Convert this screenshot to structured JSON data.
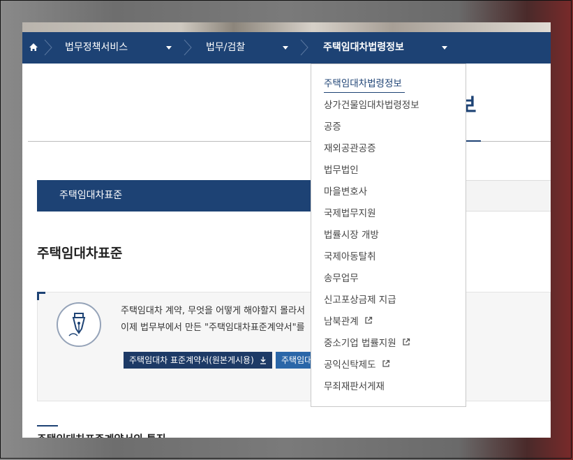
{
  "nav": {
    "items": [
      {
        "label": "법무정책서비스"
      },
      {
        "label": "법무/검찰"
      },
      {
        "label": "주택임대차법령정보"
      }
    ]
  },
  "page": {
    "title_partial": "보",
    "tab_active": "주택임대차표준",
    "section_title": "주택임대차표준",
    "info_line1": "주택임대차 계약, 무엇을 어떻게 해야할지 몰라서",
    "info_line2": "이제 법무부에서 만든 \"주택임대차표준계약서\"를",
    "btn_download": "주택임대차 표준계약서(원본게시용)",
    "btn_partial": "주택임대",
    "bottom_title": "주택임대차표준계약서의 특징"
  },
  "dropdown": {
    "items": [
      {
        "label": "주택임대차법령정보",
        "active": true,
        "external": false
      },
      {
        "label": "상가건물임대차법령정보",
        "external": false
      },
      {
        "label": "공증",
        "external": false
      },
      {
        "label": "재외공관공증",
        "external": false
      },
      {
        "label": "법무법인",
        "external": false
      },
      {
        "label": "마을변호사",
        "external": false
      },
      {
        "label": "국제법무지원",
        "external": false
      },
      {
        "label": "법률시장 개방",
        "external": false
      },
      {
        "label": "국제아동탈취",
        "external": false
      },
      {
        "label": "송무업무",
        "external": false
      },
      {
        "label": "신고포상금제 지급",
        "external": false
      },
      {
        "label": "남북관계",
        "external": true
      },
      {
        "label": "중소기업 법률지원",
        "external": true
      },
      {
        "label": "공익신탁제도",
        "external": true
      },
      {
        "label": "무죄재판서게재",
        "external": false
      }
    ]
  },
  "colors": {
    "navy": "#1d4274",
    "button_dark": "#1d3a66",
    "button_blue": "#2a66a8"
  }
}
